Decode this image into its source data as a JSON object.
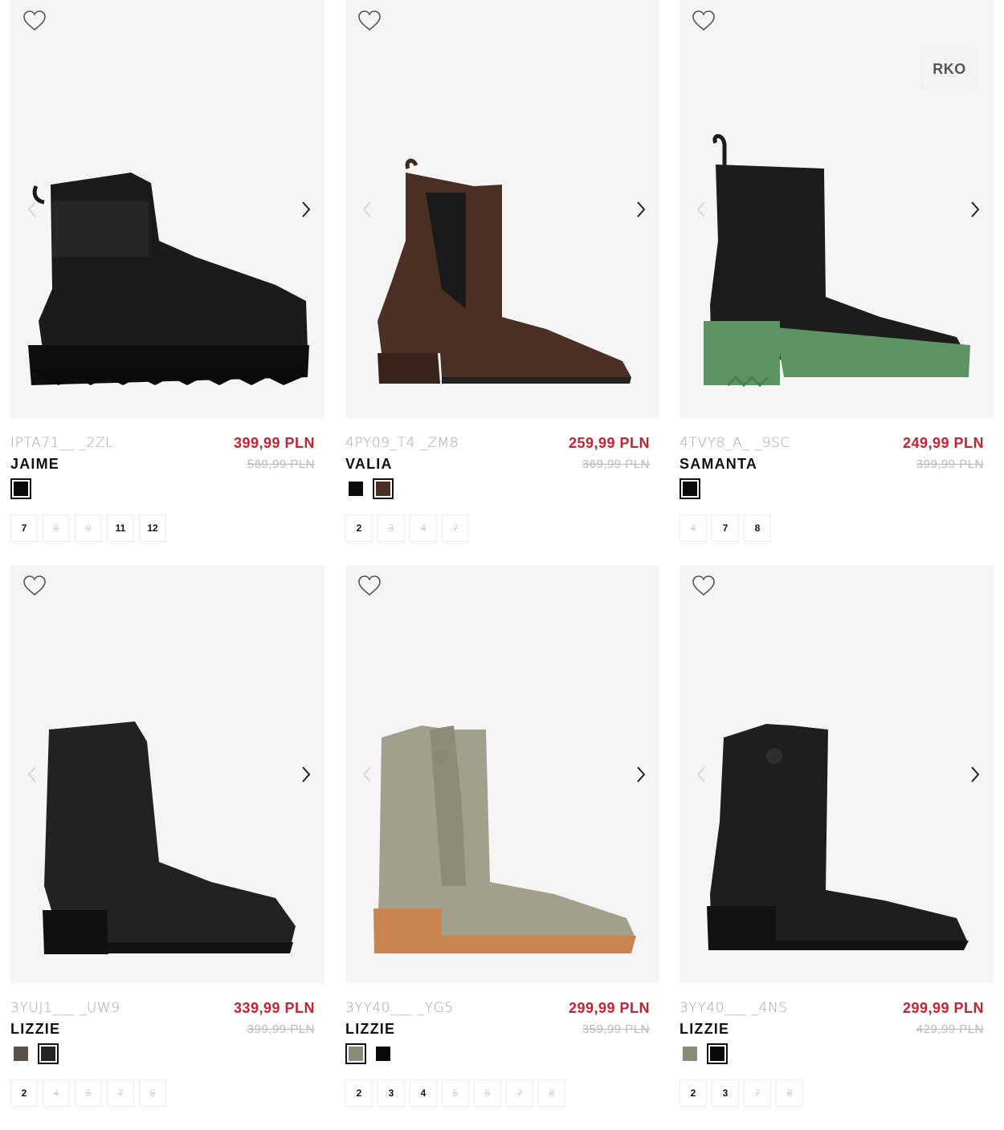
{
  "products": [
    {
      "sku": "IPTA71__ _2ZL",
      "name": "JAIME",
      "price": "399,99 PLN",
      "old_price": "569,99 PLN",
      "badge": "",
      "swatches": [
        {
          "color": "#0a0a0a",
          "selected": true
        }
      ],
      "sizes": [
        {
          "label": "7",
          "available": true
        },
        {
          "label": "8",
          "available": false
        },
        {
          "label": "9",
          "available": false
        },
        {
          "label": "11",
          "available": true
        },
        {
          "label": "12",
          "available": true
        }
      ]
    },
    {
      "sku": "4PY09_T4 _ZM8",
      "name": "VALIA",
      "price": "259,99 PLN",
      "old_price": "369,99 PLN",
      "badge": "",
      "swatches": [
        {
          "color": "#0a0a0a",
          "selected": false
        },
        {
          "color": "#4a2f22",
          "selected": true
        }
      ],
      "sizes": [
        {
          "label": "2",
          "available": true
        },
        {
          "label": "3",
          "available": false
        },
        {
          "label": "4",
          "available": false
        },
        {
          "label": "7",
          "available": false
        }
      ]
    },
    {
      "sku": "4TVY8_A_ _9SC",
      "name": "SAMANTA",
      "price": "249,99 PLN",
      "old_price": "399,99 PLN",
      "badge": "RKO",
      "swatches": [
        {
          "color": "#0a0a0a",
          "selected": true
        }
      ],
      "sizes": [
        {
          "label": "4",
          "available": false
        },
        {
          "label": "7",
          "available": true
        },
        {
          "label": "8",
          "available": true
        }
      ]
    },
    {
      "sku": "3YUJ1___ _UW9",
      "name": "LIZZIE",
      "price": "339,99 PLN",
      "old_price": "399,99 PLN",
      "badge": "",
      "swatches": [
        {
          "color": "#5a5148",
          "selected": false
        },
        {
          "color": "#23252a",
          "selected": true
        }
      ],
      "sizes": [
        {
          "label": "2",
          "available": true
        },
        {
          "label": "4",
          "available": false
        },
        {
          "label": "6",
          "available": false
        },
        {
          "label": "7",
          "available": false
        },
        {
          "label": "8",
          "available": false
        }
      ]
    },
    {
      "sku": "3YY40___ _YG5",
      "name": "LIZZIE",
      "price": "299,99 PLN",
      "old_price": "359,99 PLN",
      "badge": "",
      "swatches": [
        {
          "color": "#8c8a74",
          "selected": true
        },
        {
          "color": "#0a0a0a",
          "selected": false
        }
      ],
      "sizes": [
        {
          "label": "2",
          "available": true
        },
        {
          "label": "3",
          "available": true
        },
        {
          "label": "4",
          "available": true
        },
        {
          "label": "5",
          "available": false
        },
        {
          "label": "6",
          "available": false
        },
        {
          "label": "7",
          "available": false
        },
        {
          "label": "8",
          "available": false
        }
      ]
    },
    {
      "sku": "3YY40___ _4NS",
      "name": "LIZZIE",
      "price": "299,99 PLN",
      "old_price": "429,99 PLN",
      "badge": "",
      "swatches": [
        {
          "color": "#8c8a74",
          "selected": false
        },
        {
          "color": "#0a0a0a",
          "selected": true
        }
      ],
      "sizes": [
        {
          "label": "2",
          "available": true
        },
        {
          "label": "3",
          "available": true
        },
        {
          "label": "7",
          "available": false
        },
        {
          "label": "8",
          "available": false
        }
      ]
    }
  ],
  "colors": {
    "price_red": "#c32430",
    "image_bg": "#f5f5f5"
  },
  "icons": {
    "favorite": "heart-icon",
    "next": "chevron-right-icon",
    "prev": "chevron-left-icon"
  }
}
